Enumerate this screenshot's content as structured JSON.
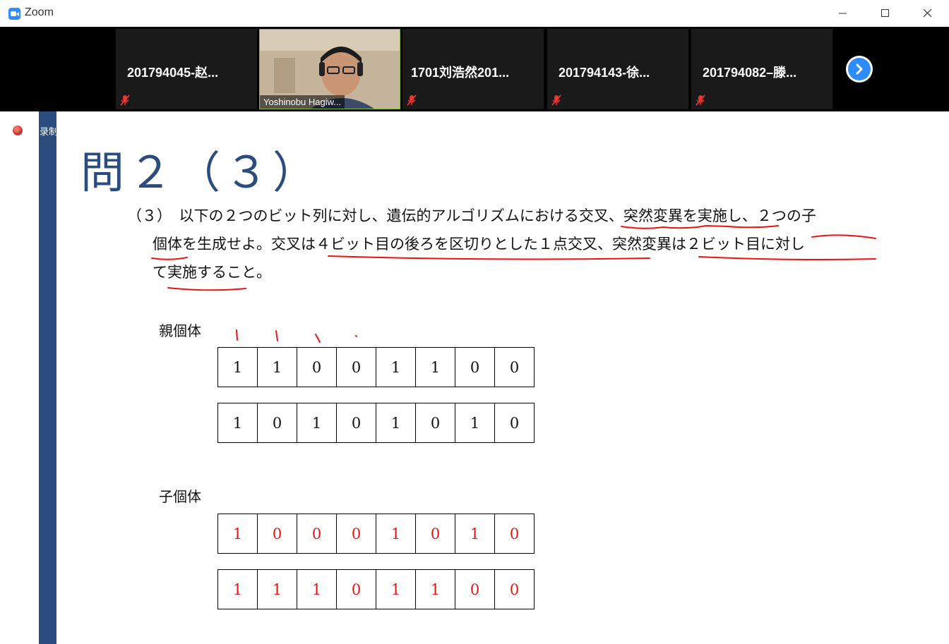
{
  "window": {
    "title": "Zoom"
  },
  "participants": [
    {
      "name": "201794045-赵...",
      "muted": true,
      "video": false
    },
    {
      "name": "Yoshinobu Hagiw...",
      "muted": false,
      "video": true
    },
    {
      "name": "1701刘浩然201...",
      "muted": true,
      "video": false
    },
    {
      "name": "201794143-徐...",
      "muted": true,
      "video": false
    },
    {
      "name": "201794082–滕...",
      "muted": true,
      "video": false
    }
  ],
  "recording": {
    "label": "录制"
  },
  "slide": {
    "title": "問２（３）",
    "paragraph_lines": [
      "（３）　以下の２つのビット列に対し、遺伝的アルゴリズムにおける交叉、突然変異を実施し、２つの子",
      "個体を生成せよ。交叉は４ビット目の後ろを区切りとした１点交叉、突然変異は２ビット目に対し",
      "て実施すること。"
    ],
    "parent_label": "親個体",
    "child_label": "子個体",
    "parents": [
      [
        "1",
        "1",
        "0",
        "0",
        "1",
        "1",
        "0",
        "0"
      ],
      [
        "1",
        "0",
        "1",
        "0",
        "1",
        "0",
        "1",
        "0"
      ]
    ],
    "children": [
      [
        "1",
        "0",
        "0",
        "0",
        "1",
        "0",
        "1",
        "0"
      ],
      [
        "1",
        "1",
        "1",
        "0",
        "1",
        "1",
        "0",
        "0"
      ]
    ]
  },
  "colors": {
    "accent": "#2b4c7e",
    "annotation": "#e11111",
    "zoom_blue": "#2d8cff"
  }
}
